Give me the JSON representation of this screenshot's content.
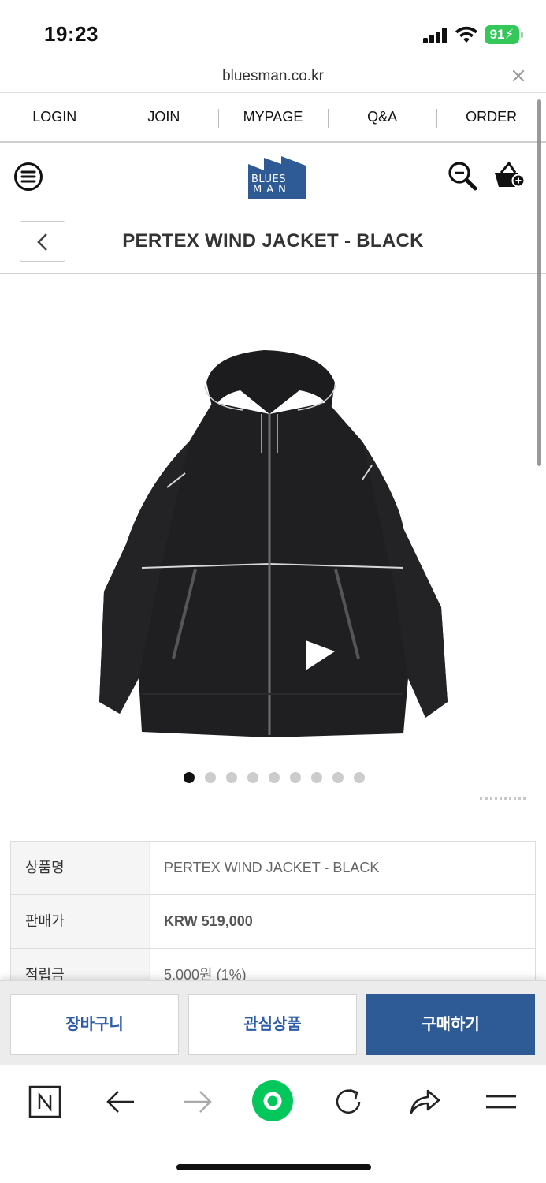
{
  "status_bar": {
    "time": "19:23",
    "battery": "91"
  },
  "browser": {
    "url": "bluesman.co.kr"
  },
  "top_nav": [
    "LOGIN",
    "JOIN",
    "MYPAGE",
    "Q&A",
    "ORDER"
  ],
  "logo": {
    "line1": "BLUES",
    "line2": "MAN",
    "color": "#2e5a96"
  },
  "page": {
    "title": "PERTEX WIND JACKET - BLACK"
  },
  "gallery": {
    "total": 9,
    "active_index": 0
  },
  "product_info": [
    {
      "label": "상품명",
      "value": "PERTEX WIND JACKET - BLACK"
    },
    {
      "label": "판매가",
      "value": "KRW 519,000"
    },
    {
      "label": "적립금",
      "value": "5,000원 (1%)"
    }
  ],
  "actions": {
    "cart": "장바구니",
    "wishlist": "관심상품",
    "buy": "구매하기"
  },
  "icons": {
    "menu": "hamburger-circle-icon",
    "search": "magnifier-icon",
    "cart": "basket-plus-icon",
    "back": "chevron-left-icon",
    "toolbar": [
      "naver-n-icon",
      "back-arrow-icon",
      "forward-arrow-icon",
      "green-dot-icon",
      "reload-icon",
      "share-icon",
      "menu-lines-icon"
    ]
  },
  "colors": {
    "accent": "#2e5a96",
    "battery": "#34c759",
    "green": "#03c75a"
  }
}
